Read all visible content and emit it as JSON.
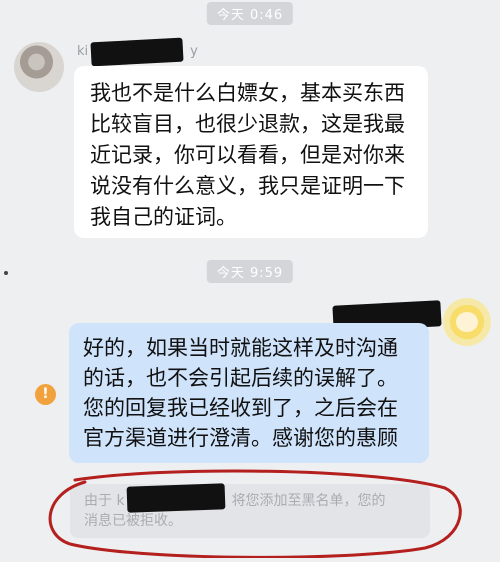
{
  "timestamps": [
    "今天 0:46",
    "今天 9:59"
  ],
  "contact_left": {
    "name_start": "ki",
    "name_end": "y"
  },
  "messages": {
    "left_lines": [
      "我也不是什么白嫖女，基本买东西",
      "比较盲目，也很少退款，这是我最",
      "近记录，你可以看看，但是对你来",
      "说没有什么意义，我只是证明一下",
      "我自己的证词。"
    ],
    "right_lines": [
      "好的，如果当时就能这样及时沟通",
      "的话，也不会引起后续的误解了。",
      "您的回复我已经收到了，之后会在",
      "官方渠道进行澄清。感谢您的惠顾"
    ]
  },
  "notice": {
    "prefix": "由于 k",
    "suffix_line1": "将您添加至黑名单，您的",
    "line2": "消息已被拒收。"
  },
  "info_icon_glyph": "!",
  "annotation_color": "#b3201e"
}
